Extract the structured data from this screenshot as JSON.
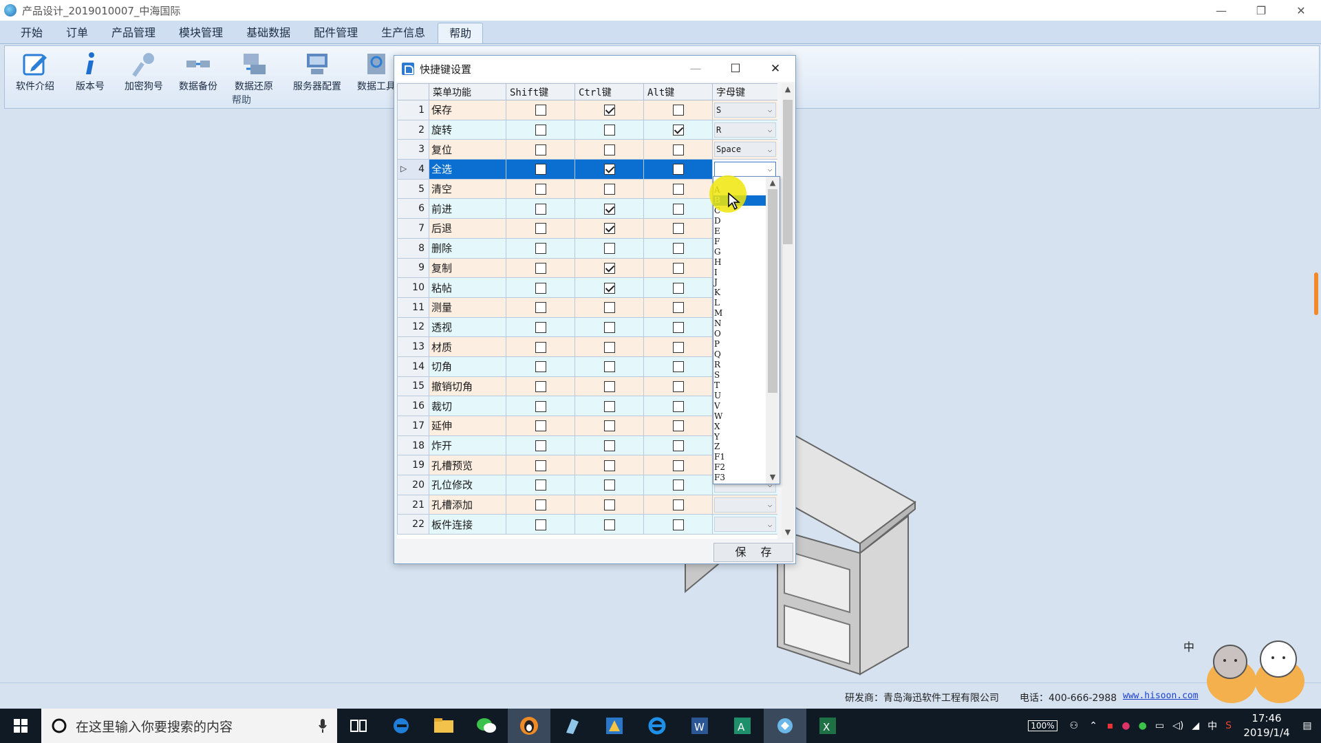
{
  "window": {
    "title": "产品设计_2019010007_中海国际",
    "controls": [
      "—",
      "❐",
      "✕"
    ]
  },
  "menu": {
    "tabs": [
      "开始",
      "订单",
      "产品管理",
      "模块管理",
      "基础数据",
      "配件管理",
      "生产信息",
      "帮助"
    ],
    "active": "帮助"
  },
  "ribbon": {
    "buttons": [
      "软件介绍",
      "版本号",
      "加密狗号",
      "数据备份",
      "数据还原",
      "服务器配置",
      "数据工具"
    ],
    "group_label": "帮助"
  },
  "dialog": {
    "title": "快捷键设置",
    "controls": [
      "—",
      "☐",
      "✕"
    ],
    "columns": [
      "菜单功能",
      "Shift键",
      "Ctrl键",
      "Alt键",
      "字母键"
    ],
    "rows": [
      {
        "n": "1",
        "fn": "保存",
        "shift": false,
        "ctrl": true,
        "alt": false,
        "key": "S"
      },
      {
        "n": "2",
        "fn": "旋转",
        "shift": false,
        "ctrl": false,
        "alt": true,
        "key": "R"
      },
      {
        "n": "3",
        "fn": "复位",
        "shift": false,
        "ctrl": false,
        "alt": false,
        "key": "Space"
      },
      {
        "n": "4",
        "fn": "全选",
        "shift": false,
        "ctrl": true,
        "alt": false,
        "key": ""
      },
      {
        "n": "5",
        "fn": "清空",
        "shift": false,
        "ctrl": false,
        "alt": false,
        "key": ""
      },
      {
        "n": "6",
        "fn": "前进",
        "shift": false,
        "ctrl": true,
        "alt": false,
        "key": ""
      },
      {
        "n": "7",
        "fn": "后退",
        "shift": false,
        "ctrl": true,
        "alt": false,
        "key": ""
      },
      {
        "n": "8",
        "fn": "删除",
        "shift": false,
        "ctrl": false,
        "alt": false,
        "key": ""
      },
      {
        "n": "9",
        "fn": "复制",
        "shift": false,
        "ctrl": true,
        "alt": false,
        "key": ""
      },
      {
        "n": "10",
        "fn": "粘帖",
        "shift": false,
        "ctrl": true,
        "alt": false,
        "key": ""
      },
      {
        "n": "11",
        "fn": "测量",
        "shift": false,
        "ctrl": false,
        "alt": false,
        "key": ""
      },
      {
        "n": "12",
        "fn": "透视",
        "shift": false,
        "ctrl": false,
        "alt": false,
        "key": ""
      },
      {
        "n": "13",
        "fn": "材质",
        "shift": false,
        "ctrl": false,
        "alt": false,
        "key": ""
      },
      {
        "n": "14",
        "fn": "切角",
        "shift": false,
        "ctrl": false,
        "alt": false,
        "key": ""
      },
      {
        "n": "15",
        "fn": "撤销切角",
        "shift": false,
        "ctrl": false,
        "alt": false,
        "key": ""
      },
      {
        "n": "16",
        "fn": "裁切",
        "shift": false,
        "ctrl": false,
        "alt": false,
        "key": ""
      },
      {
        "n": "17",
        "fn": "延伸",
        "shift": false,
        "ctrl": false,
        "alt": false,
        "key": ""
      },
      {
        "n": "18",
        "fn": "炸开",
        "shift": false,
        "ctrl": false,
        "alt": false,
        "key": ""
      },
      {
        "n": "19",
        "fn": "孔槽预览",
        "shift": false,
        "ctrl": false,
        "alt": false,
        "key": ""
      },
      {
        "n": "20",
        "fn": "孔位修改",
        "shift": false,
        "ctrl": false,
        "alt": false,
        "key": ""
      },
      {
        "n": "21",
        "fn": "孔槽添加",
        "shift": false,
        "ctrl": false,
        "alt": false,
        "key": ""
      },
      {
        "n": "22",
        "fn": "板件连接",
        "shift": false,
        "ctrl": false,
        "alt": false,
        "key": ""
      }
    ],
    "selected_row": "4",
    "dropdown_options": [
      "A",
      "B",
      "C",
      "D",
      "E",
      "F",
      "G",
      "H",
      "I",
      "J",
      "K",
      "L",
      "M",
      "N",
      "O",
      "P",
      "Q",
      "R",
      "S",
      "T",
      "U",
      "V",
      "W",
      "X",
      "Y",
      "Z",
      "F1",
      "F2",
      "F3"
    ],
    "dropdown_highlight": "B",
    "save_label": "保 存"
  },
  "status": {
    "developer": "研发商：青岛海迅软件工程有限公司",
    "phone": "电话：400-666-2988",
    "url": "www.hisoon.com"
  },
  "taskbar": {
    "search_placeholder": "在这里输入你要搜索的内容",
    "battery": "100%",
    "ime": "中",
    "time": "17:46",
    "date": "2019/1/4"
  },
  "colors": {
    "selection": "#0a6fd0",
    "row_odd": "#fdeee2",
    "row_even": "#e4f8fb"
  }
}
